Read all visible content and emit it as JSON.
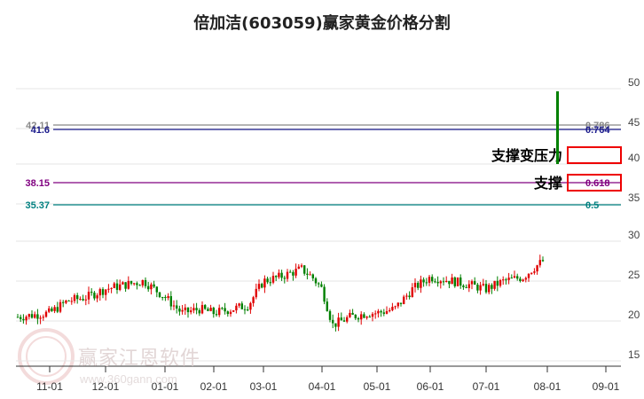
{
  "title": "倍加洁(603059)赢家黄金价格分割",
  "watermark": {
    "name": "赢家江恩软件",
    "url": "www.360gann.com",
    "seal": "江赢恩家"
  },
  "chart_data": {
    "type": "candlestick",
    "title": "倍加洁(603059)赢家黄金价格分割",
    "y_ticks": [
      50,
      45,
      40,
      35,
      30,
      25,
      20,
      15
    ],
    "x_ticks": [
      "11-01",
      "12-01",
      "01-01",
      "02-01",
      "03-01",
      "04-01",
      "05-01",
      "06-01",
      "07-01",
      "08-01",
      "09-01"
    ],
    "grid": true,
    "price_path": [
      [
        "10-25",
        20.5
      ],
      [
        "11-01",
        21.0
      ],
      [
        "11-10",
        22.5
      ],
      [
        "11-20",
        23.0
      ],
      [
        "12-01",
        24.0
      ],
      [
        "12-10",
        24.5
      ],
      [
        "12-20",
        25.0
      ],
      [
        "01-01",
        23.0
      ],
      [
        "01-10",
        21.0
      ],
      [
        "01-20",
        21.5
      ],
      [
        "02-01",
        21.0
      ],
      [
        "02-15",
        21.5
      ],
      [
        "02-22",
        22.0
      ],
      [
        "03-01",
        25.0
      ],
      [
        "03-10",
        25.5
      ],
      [
        "03-20",
        26.5
      ],
      [
        "03-25",
        25.5
      ],
      [
        "04-01",
        24.0
      ],
      [
        "04-05",
        19.5
      ],
      [
        "04-15",
        20.5
      ],
      [
        "04-25",
        21.0
      ],
      [
        "05-01",
        21.0
      ],
      [
        "05-10",
        21.5
      ],
      [
        "05-20",
        24.0
      ],
      [
        "06-01",
        25.5
      ],
      [
        "06-15",
        25.0
      ],
      [
        "06-25",
        24.5
      ],
      [
        "07-01",
        24.0
      ],
      [
        "07-10",
        25.0
      ],
      [
        "07-20",
        25.5
      ],
      [
        "07-25",
        26.5
      ],
      [
        "08-01",
        27.5
      ],
      [
        "08-02",
        30.0
      ]
    ],
    "spike_candle": {
      "open": 40,
      "close": 49.5,
      "color": "#008000"
    },
    "levels": [
      {
        "price": "42.11",
        "ratio": "0.786",
        "color": "#888888"
      },
      {
        "price": "41.6",
        "ratio": "0.764",
        "color": "#1a1a8c",
        "tag": "支撑变压力",
        "boxed": true
      },
      {
        "price": "38.15",
        "ratio": "0.618",
        "color": "#800080",
        "tag": "支撑",
        "boxed": true
      },
      {
        "price": "35.37",
        "ratio": "0.5",
        "color": "#008080"
      }
    ]
  }
}
